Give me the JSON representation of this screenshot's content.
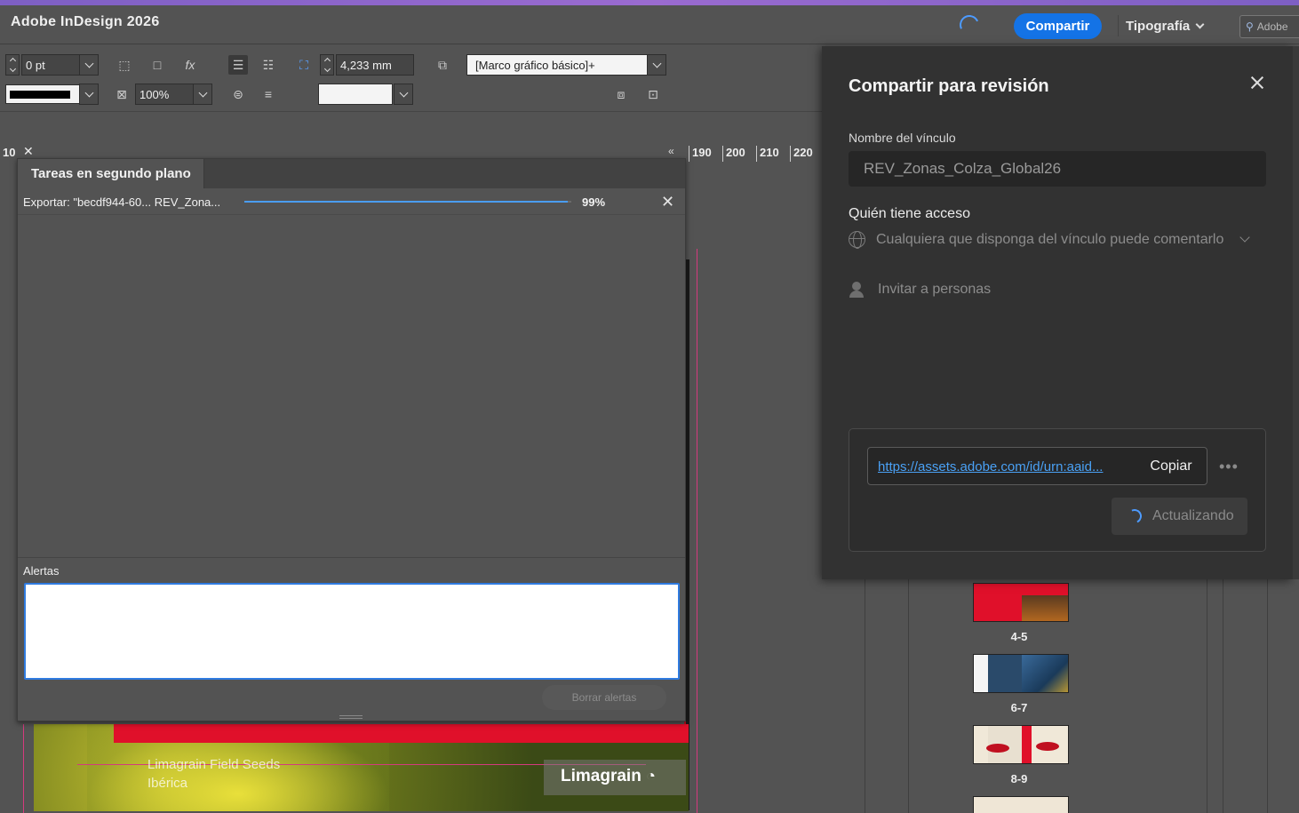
{
  "app": {
    "title": "Adobe InDesign 2026"
  },
  "topbar": {
    "share_label": "Compartir",
    "workspace_label": "Tipografía",
    "search_placeholder": "Adobe"
  },
  "controls": {
    "stroke_weight": "0 pt",
    "opacity": "100%",
    "dimension": "4,233 mm",
    "object_style": "[Marco gráfico básico]+"
  },
  "ruler": {
    "left_num": "10",
    "ticks": [
      "190",
      "200",
      "210",
      "220"
    ]
  },
  "tasks_panel": {
    "tab_label": "Tareas en segundo plano",
    "task_label": "Exportar: \"becdf944-60...  REV_Zona...",
    "progress_percent_text": "99%",
    "progress_value": 0.99,
    "alerts_label": "Alertas",
    "clear_alerts_label": "Borrar alertas"
  },
  "document": {
    "text_line1": "Limagrain Field Seeds",
    "text_line2": "Ibérica",
    "logo_text": "Limagrain"
  },
  "share_dialog": {
    "title": "Compartir para revisión",
    "link_name_label": "Nombre del vínculo",
    "link_name_value": "REV_Zonas_Colza_Global26",
    "access_label": "Quién tiene acceso",
    "access_value": "Cualquiera que disponga del vínculo puede comentarlo",
    "invite_label": "Invitar a personas",
    "link_url": "https://assets.adobe.com/id/urn:aaid...",
    "copy_label": "Copiar",
    "more_label": "•••",
    "updating_label": "Actualizando"
  },
  "pages_panel": {
    "spreads": [
      {
        "label": "4-5"
      },
      {
        "label": "6-7"
      },
      {
        "label": "8-9"
      }
    ]
  },
  "colors": {
    "accent": "#1473e6",
    "link": "#4aa1f5",
    "progress": "#4a9df0",
    "brand_red": "#e0102a"
  }
}
